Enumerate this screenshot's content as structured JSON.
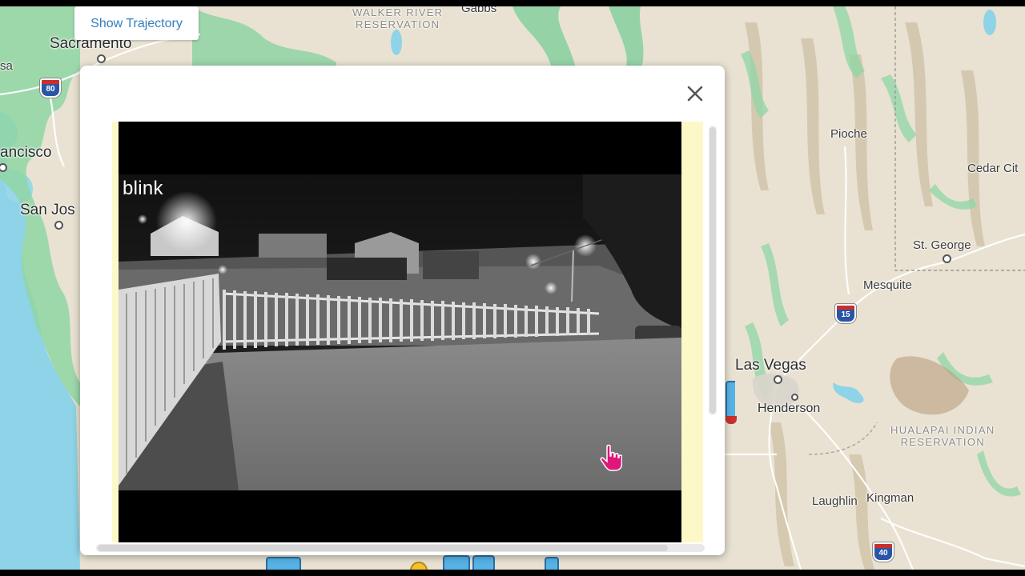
{
  "map": {
    "labels": {
      "sacramento": "Sacramento",
      "san_francisco": "ancisco",
      "san_jose": "San Jos",
      "edge_left": "sa",
      "walker_river_reservation": "WALKER RIVER\nRESERVATION",
      "gabbs": "Gabbs",
      "pioche": "Pioche",
      "cedar_city": "Cedar Cit",
      "st_george": "St. George",
      "mesquite": "Mesquite",
      "las_vegas": "Las Vegas",
      "henderson": "Henderson",
      "hualapai_reservation": "HUALAPAI INDIAN\nRESERVATION",
      "laughlin": "Laughlin",
      "kingman": "Kingman"
    },
    "shields": {
      "i80_top": "80",
      "i15": "15",
      "i40_bottom": "40"
    },
    "colors": {
      "water": "#8fd3e8",
      "land": "#e9e2d2",
      "vegetation": "#7fcf9c",
      "shield": "#2a55a6"
    }
  },
  "controls": {
    "show_trajectory_label": "Show Trajectory"
  },
  "modal": {
    "close_icon": "close-icon",
    "video": {
      "logo_text": "blink"
    }
  }
}
